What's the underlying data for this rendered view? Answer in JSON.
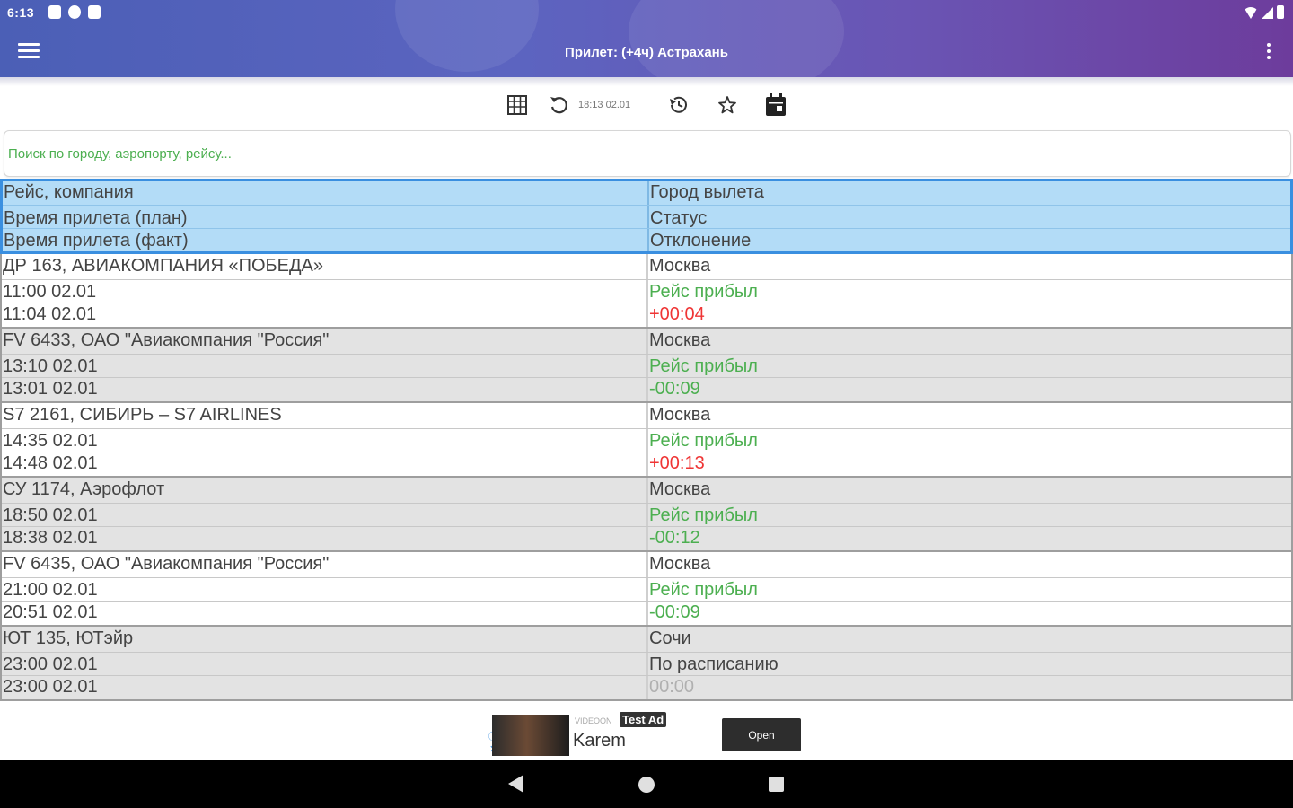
{
  "status_bar": {
    "time": "6:13"
  },
  "app_bar": {
    "title": "Прилет: (+4ч) Астрахань"
  },
  "toolbar": {
    "updated_time": "18:13 02.01"
  },
  "search": {
    "placeholder": "Поиск по городу, аэропорту, рейсу..."
  },
  "table": {
    "header": {
      "left": [
        "Рейс, компания",
        "Время прилета (план)",
        "Время прилета (факт)"
      ],
      "right": [
        "Город вылета",
        "Статус",
        "Отклонение"
      ]
    },
    "flights": [
      {
        "flight": "ДР 163, АВИАКОМПАНИЯ «ПОБЕДА»",
        "planned": "11:00 02.01",
        "actual": "11:04 02.01",
        "city": "Москва",
        "status": "Рейс прибыл",
        "deviation": "+00:04"
      },
      {
        "flight": "FV 6433, ОАО \"Авиакомпания \"Россия\"",
        "planned": "13:10 02.01",
        "actual": "13:01 02.01",
        "city": "Москва",
        "status": "Рейс прибыл",
        "deviation": "-00:09"
      },
      {
        "flight": "S7 2161, СИБИРЬ – S7 AIRLINES",
        "planned": "14:35 02.01",
        "actual": "14:48 02.01",
        "city": "Москва",
        "status": "Рейс прибыл",
        "deviation": "+00:13"
      },
      {
        "flight": "СУ 1174, Аэрофлот",
        "planned": "18:50 02.01",
        "actual": "18:38 02.01",
        "city": "Москва",
        "status": "Рейс прибыл",
        "deviation": "-00:12"
      },
      {
        "flight": "FV 6435, ОАО \"Авиакомпания \"Россия\"",
        "planned": "21:00 02.01",
        "actual": "20:51 02.01",
        "city": "Москва",
        "status": "Рейс прибыл",
        "deviation": "-00:09"
      },
      {
        "flight": "ЮТ 135, ЮТэйр",
        "planned": "23:00 02.01",
        "actual": "23:00 02.01",
        "city": "Сочи",
        "status": "По расписанию",
        "deviation": "00:00"
      }
    ]
  },
  "ad": {
    "small_text": "VIDEOON",
    "badge": "Test Ad",
    "title": "Karem",
    "open_label": "Open"
  },
  "colors": {
    "accent_green": "#4caf50",
    "late_red": "#ef3535",
    "header_blue": "#b3dcf7",
    "header_border": "#3a8fe0",
    "gradient_start": "#4b5fb6",
    "gradient_end": "#6d3c9c"
  }
}
